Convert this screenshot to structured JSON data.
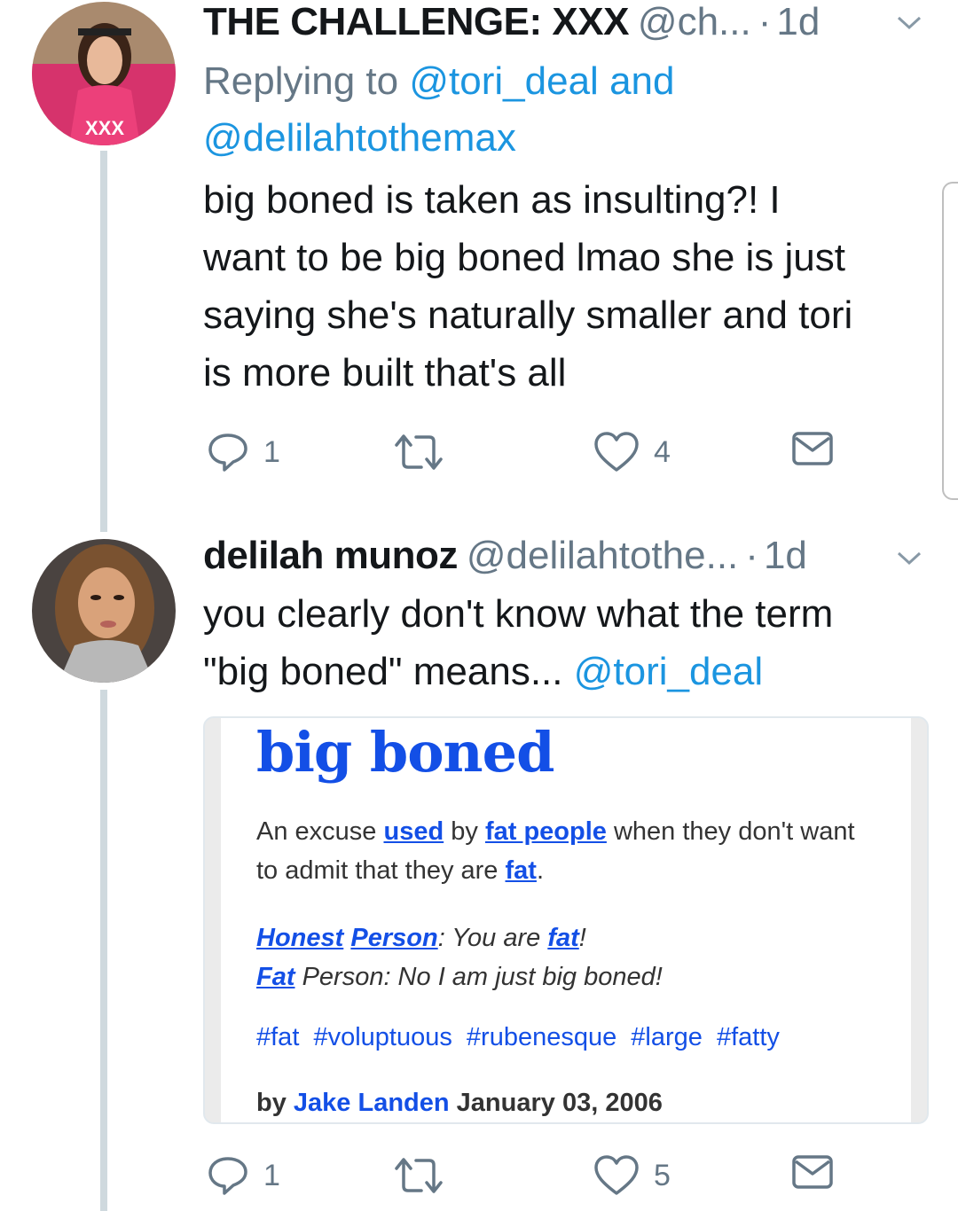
{
  "tweets": [
    {
      "display_name": "THE CHALLENGE: XXX",
      "handle": "@ch...",
      "separator": "·",
      "time": "1d",
      "reply_prefix": "Replying to",
      "reply_mention_1": "@tori_deal",
      "reply_and": "and",
      "reply_mention_2": "@delilahtothemax",
      "text_lines": [
        "big boned is taken as insulting?! I",
        "want to be big boned lmao she is just",
        "saying she's naturally smaller and tori",
        "is more built that's all"
      ],
      "reply_count": "1",
      "like_count": "4"
    },
    {
      "display_name": "delilah munoz",
      "handle": "@delilahtothe...",
      "separator": "·",
      "time": "1d",
      "text_line_1": "you clearly don't know what the term",
      "text_line_2": "\"big boned\" means...",
      "mention": "@tori_deal",
      "reply_count": "1",
      "like_count": "5"
    }
  ],
  "card": {
    "title": "big boned",
    "def_1": "An excuse",
    "def_link_used": "used",
    "def_2": "by",
    "def_link_fat_people": "fat people",
    "def_3": "when they don't want to admit that they are",
    "def_link_fat": "fat",
    "def_4": ".",
    "ex_link_honest": "Honest",
    "ex_link_person": "Person",
    "ex_1": ": You are",
    "ex_link_fat": "fat",
    "ex_2": "!",
    "ex_link_fat2": "Fat",
    "ex_3": "Person: No I am just big boned!",
    "tags": [
      "#fat",
      "#voluptuous",
      "#rubenesque",
      "#large",
      "#fatty"
    ],
    "by_label": "by",
    "author": "Jake Landen",
    "date": "January 03, 2006"
  },
  "colors": {
    "link": "#1b95e0",
    "muted": "#657786",
    "ud_blue": "#134fe6",
    "thread_line": "#cfd9de"
  },
  "icons": [
    "reply-icon",
    "retweet-icon",
    "like-icon",
    "dm-icon",
    "chevron-down-icon"
  ]
}
